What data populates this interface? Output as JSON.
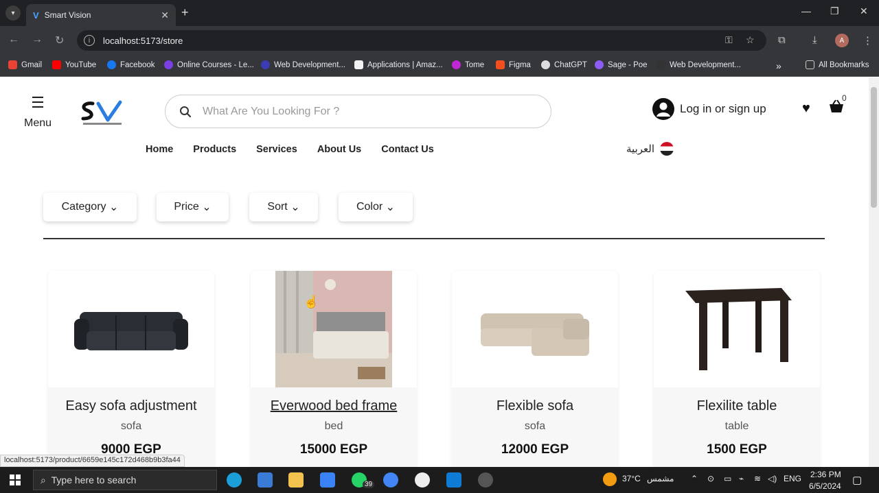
{
  "browser": {
    "tab_title": "Smart Vision",
    "tab_favicon": "V",
    "url": "localhost:5173/store",
    "profile_initial": "A",
    "bookmarks": [
      {
        "label": "Gmail",
        "color": "#ea4335"
      },
      {
        "label": "YouTube",
        "color": "#ff0000"
      },
      {
        "label": "Facebook",
        "color": "#1877f2"
      },
      {
        "label": "Online Courses - Le...",
        "color": "#7b3fe4"
      },
      {
        "label": "Web Development...",
        "color": "#3b3bb3"
      },
      {
        "label": "Applications | Amaz...",
        "color": "#f2f2f2"
      },
      {
        "label": "Tome",
        "color": "#c026d3"
      },
      {
        "label": "Figma",
        "color": "#f24e1e"
      },
      {
        "label": "ChatGPT",
        "color": "#dddddd"
      },
      {
        "label": "Sage - Poe",
        "color": "#8b5cf6"
      },
      {
        "label": "Web Development...",
        "color": "#333333"
      }
    ],
    "all_bookmarks": "All Bookmarks",
    "status_url": "localhost:5173/product/6659e145c172d468b9b3fa44"
  },
  "header": {
    "menu_label": "Menu",
    "search_placeholder": "What Are You Looking For ?",
    "login_label": "Log in or sign up",
    "cart_count": "0",
    "nav": [
      "Home",
      "Products",
      "Services",
      "About Us",
      "Contact Us"
    ],
    "language": "العربية"
  },
  "filters": [
    "Category",
    "Price",
    "Sort",
    "Color"
  ],
  "products": [
    {
      "name": "Easy sofa adjustment",
      "category": "sofa",
      "price": "9000 EGP"
    },
    {
      "name": "Everwood bed frame",
      "category": "bed",
      "price": "15000 EGP"
    },
    {
      "name": "Flexible sofa",
      "category": "sofa",
      "price": "12000 EGP"
    },
    {
      "name": "Flexilite table",
      "category": "table",
      "price": "1500 EGP"
    }
  ],
  "taskbar": {
    "search_placeholder": "Type here to search",
    "whatsapp_badge": "39",
    "weather": "37°C",
    "weather_label": "مشمس",
    "lang": "ENG",
    "time": "2:36 PM",
    "date": "6/5/2024"
  },
  "colors": {
    "accent_dark": "#111111",
    "brand_blue": "#2a7de1"
  }
}
